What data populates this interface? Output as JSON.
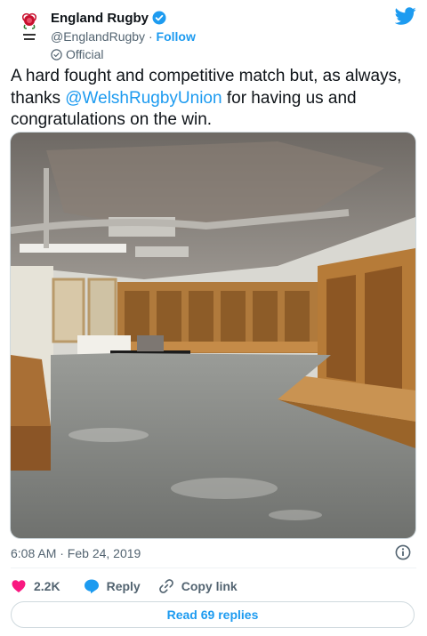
{
  "author": {
    "display_name": "England Rugby",
    "handle": "@EnglandRugby",
    "separator": "·",
    "follow_label": "Follow",
    "affiliation": "Official"
  },
  "tweet": {
    "text_before": "A hard fought and competitive match but, as always, thanks ",
    "mention": "@WelshRugbyUnion",
    "text_after": " for having us and congratulations on the win."
  },
  "meta": {
    "timestamp": "6:08 AM · Feb 24, 2019"
  },
  "actions": {
    "likes": "2.2K",
    "reply_label": "Reply",
    "copy_link_label": "Copy link"
  },
  "replies_button": "Read 69 replies",
  "icons": {
    "twitter_logo": "twitter-bird-icon",
    "verified": "verified-badge-icon",
    "official": "official-check-icon",
    "info": "info-icon",
    "heart": "heart-icon",
    "reply": "reply-bubble-icon",
    "link": "link-icon"
  },
  "colors": {
    "accent": "#1d9bf0",
    "heart": "#f91880",
    "secondary_text": "#536471",
    "border": "#cfd9de"
  }
}
